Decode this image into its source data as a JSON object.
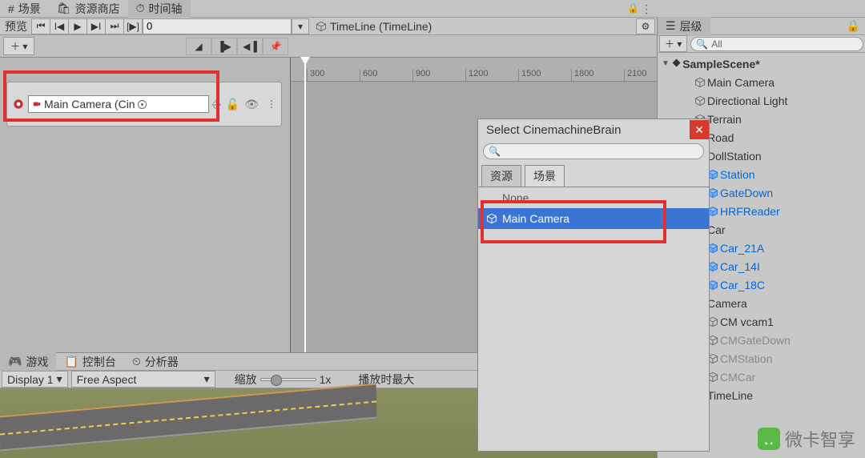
{
  "top_tabs": {
    "scene": "场景",
    "asset_store": "资源商店",
    "timeline": "时间轴"
  },
  "timeline_toolbar": {
    "preview": "预览",
    "frame": "0",
    "asset_name": "TimeLine (TimeLine)"
  },
  "timeline_ruler": [
    "300",
    "600",
    "900",
    "1200",
    "1500",
    "1800",
    "2100"
  ],
  "track": {
    "binding_label": "Main Camera (Cin"
  },
  "popup": {
    "title": "Select CinemachineBrain",
    "search_placeholder": "",
    "tab_assets": "资源",
    "tab_scene": "场景",
    "item_none": "None",
    "item_main_camera": "Main Camera"
  },
  "bottom_tabs": {
    "game": "游戏",
    "console": "控制台",
    "profiler": "分析器"
  },
  "game_toolbar": {
    "display": "Display 1",
    "aspect": "Free Aspect",
    "scale_label": "缩放",
    "scale_value": "1x",
    "maximize": "播放时最大"
  },
  "hierarchy": {
    "title": "层级",
    "search_value": "All",
    "scene": "SampleScene*",
    "items": [
      {
        "label": "Main Camera",
        "indent": 1,
        "blue": false,
        "arrow": "",
        "icon": "cube-gray"
      },
      {
        "label": "Directional Light",
        "indent": 1,
        "blue": false,
        "arrow": "",
        "icon": "cube-gray"
      },
      {
        "label": "Terrain",
        "indent": 1,
        "blue": false,
        "arrow": "",
        "icon": "cube-gray"
      },
      {
        "label": "Road",
        "indent": 1,
        "blue": false,
        "arrow": "▶",
        "icon": "cube-gray"
      },
      {
        "label": "DollStation",
        "indent": 1,
        "blue": false,
        "arrow": "▼",
        "icon": "cube-gray"
      },
      {
        "label": "Station",
        "indent": 2,
        "blue": true,
        "arrow": "▶",
        "icon": "cube-blue"
      },
      {
        "label": "GateDown",
        "indent": 2,
        "blue": true,
        "arrow": "▶",
        "icon": "cube-blue"
      },
      {
        "label": "HRFReader",
        "indent": 2,
        "blue": true,
        "arrow": "▶",
        "icon": "cube-blue"
      },
      {
        "label": "Car",
        "indent": 1,
        "blue": false,
        "arrow": "▼",
        "icon": "cube-gray"
      },
      {
        "label": "Car_21A",
        "indent": 2,
        "blue": true,
        "arrow": "▶",
        "icon": "cube-blue"
      },
      {
        "label": "Car_14I",
        "indent": 2,
        "blue": true,
        "arrow": "▶",
        "icon": "cube-blue"
      },
      {
        "label": "Car_18C",
        "indent": 2,
        "blue": true,
        "arrow": "▶",
        "icon": "cube-blue"
      },
      {
        "label": "Camera",
        "indent": 1,
        "blue": false,
        "arrow": "▼",
        "icon": "cube-gray"
      },
      {
        "label": "CM vcam1",
        "indent": 2,
        "blue": false,
        "arrow": "",
        "icon": "cube-gray",
        "gray": false
      },
      {
        "label": "CMGateDown",
        "indent": 2,
        "blue": false,
        "arrow": "",
        "icon": "cube-gray",
        "gray": true
      },
      {
        "label": "CMStation",
        "indent": 2,
        "blue": false,
        "arrow": "",
        "icon": "cube-gray",
        "gray": true
      },
      {
        "label": "CMCar",
        "indent": 2,
        "blue": false,
        "arrow": "",
        "icon": "cube-gray",
        "gray": true
      },
      {
        "label": "TimeLine",
        "indent": 1,
        "blue": false,
        "arrow": "",
        "icon": "cube-gray"
      }
    ]
  },
  "watermark": {
    "text": "微卡智享"
  }
}
